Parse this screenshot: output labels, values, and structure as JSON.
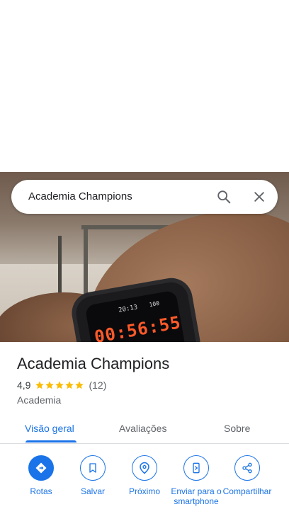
{
  "search": {
    "query": "Academia Champions",
    "search_icon": "search-icon",
    "close_icon": "close-icon"
  },
  "photo": {
    "watch_time_small": "20:13",
    "watch_battery": "100",
    "watch_time_big": "00:56:55"
  },
  "place": {
    "title": "Academia Champions",
    "rating": "4,9",
    "stars": 5,
    "reviews": "(12)",
    "category": "Academia"
  },
  "tabs": [
    {
      "label": "Visão geral",
      "active": true
    },
    {
      "label": "Avaliações",
      "active": false
    },
    {
      "label": "Sobre",
      "active": false
    }
  ],
  "actions": [
    {
      "label": "Rotas",
      "icon": "directions-icon",
      "filled": true
    },
    {
      "label": "Salvar",
      "icon": "bookmark-icon",
      "filled": false
    },
    {
      "label": "Próximo",
      "icon": "nearby-icon",
      "filled": false
    },
    {
      "label": "Enviar para o smartphone",
      "icon": "send-to-phone-icon",
      "filled": false
    },
    {
      "label": "Compartilhar",
      "icon": "share-icon",
      "filled": false
    }
  ],
  "colors": {
    "accent": "#1a73e8",
    "star": "#fbbc04",
    "text_primary": "#202124",
    "text_secondary": "#5f6368"
  }
}
